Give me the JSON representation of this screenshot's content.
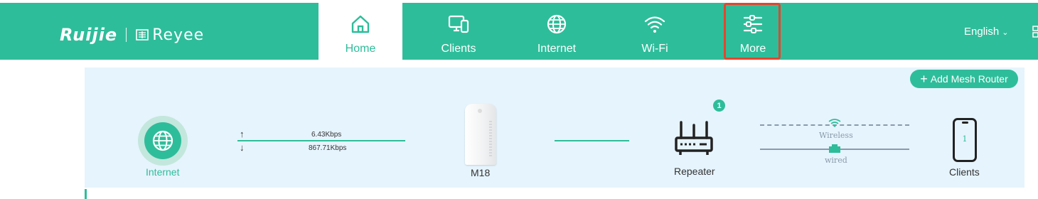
{
  "brand": {
    "logo_primary": "Ruijie",
    "logo_secondary": "Reyee"
  },
  "nav": {
    "items": [
      {
        "label": "Home",
        "icon": "home-icon",
        "active": true
      },
      {
        "label": "Clients",
        "icon": "devices-icon",
        "active": false
      },
      {
        "label": "Internet",
        "icon": "globe-icon",
        "active": false
      },
      {
        "label": "Wi-Fi",
        "icon": "wifi-icon",
        "active": false
      },
      {
        "label": "More",
        "icon": "sliders-icon",
        "active": false,
        "highlighted": true
      }
    ],
    "language": "English"
  },
  "topology": {
    "add_mesh_label": "Add Mesh Router",
    "internet_label": "Internet",
    "upload_rate": "6.43Kbps",
    "download_rate": "867.71Kbps",
    "router_label": "M18",
    "repeater_label": "Repeater",
    "repeater_count": "1",
    "wireless_label": "Wireless",
    "wired_label": "wired",
    "clients_label": "Clients",
    "clients_count": "1"
  },
  "colors": {
    "accent": "#2ebd9a",
    "highlight_border": "#e1462e",
    "panel_bg": "#e6f4fd"
  }
}
